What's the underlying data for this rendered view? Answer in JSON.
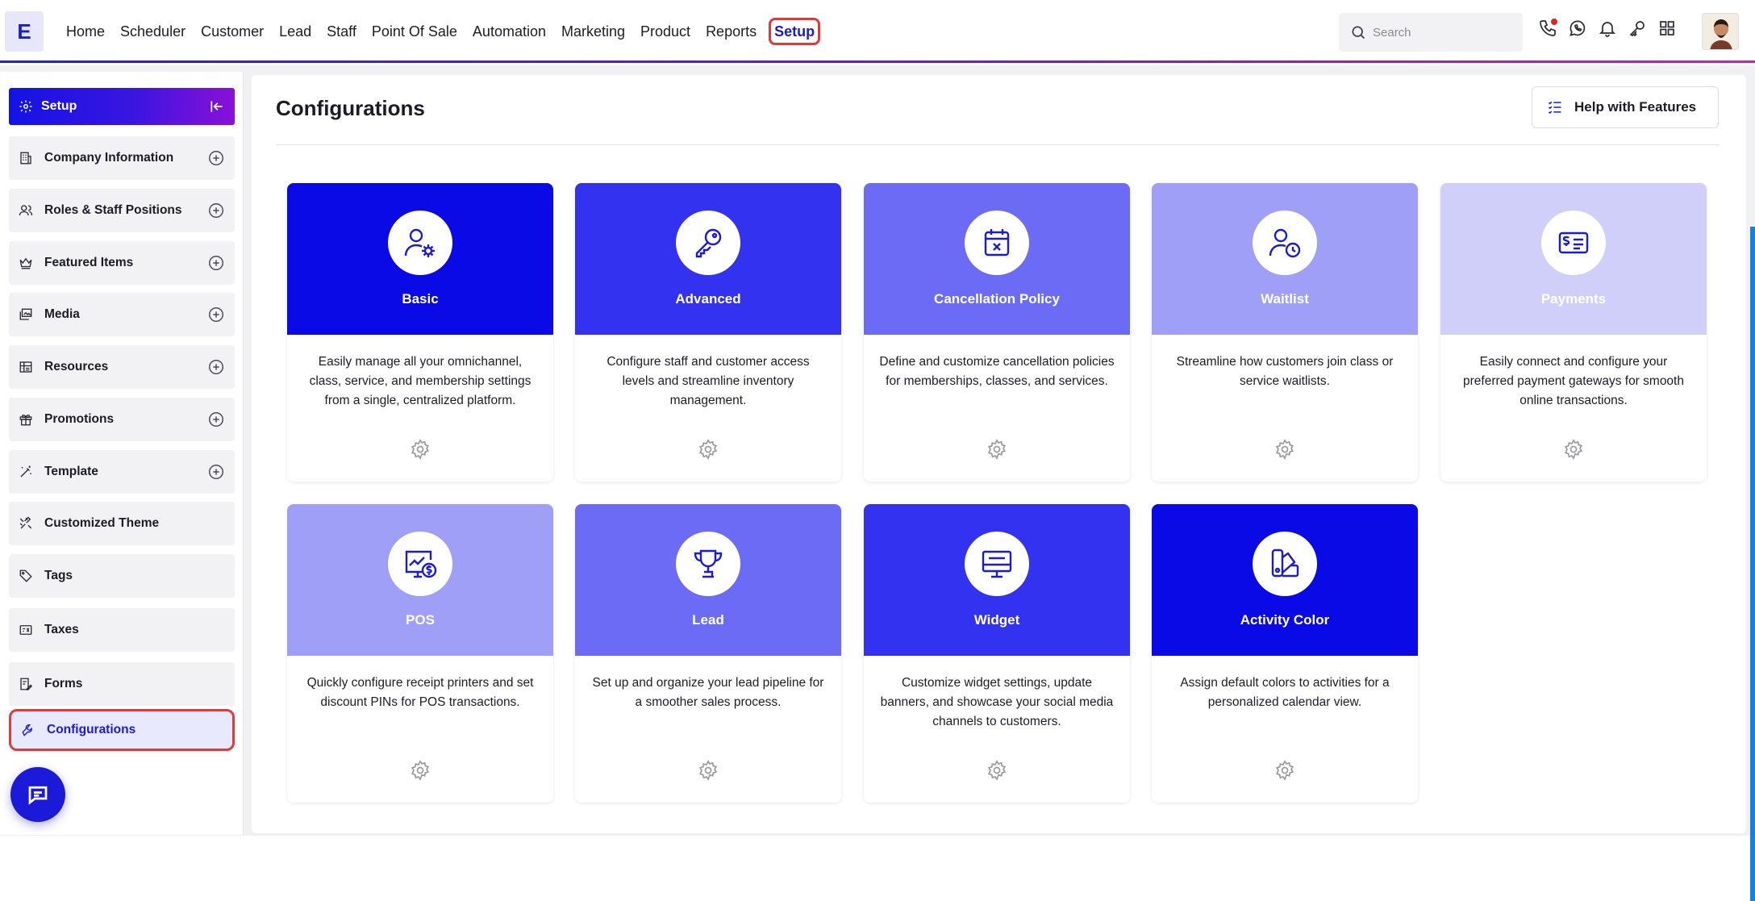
{
  "app": {
    "logo_letter": "E"
  },
  "nav": {
    "items": [
      "Home",
      "Scheduler",
      "Customer",
      "Lead",
      "Staff",
      "Point Of Sale",
      "Automation",
      "Marketing",
      "Product",
      "Reports",
      "Setup"
    ],
    "active": "Setup"
  },
  "search": {
    "placeholder": "Search"
  },
  "sidebar": {
    "title": "Setup",
    "items": [
      {
        "label": "Company Information",
        "icon": "building-icon",
        "expandable": true
      },
      {
        "label": "Roles & Staff Positions",
        "icon": "users-icon",
        "expandable": true
      },
      {
        "label": "Featured Items",
        "icon": "crown-icon",
        "expandable": true
      },
      {
        "label": "Media",
        "icon": "media-icon",
        "expandable": true
      },
      {
        "label": "Resources",
        "icon": "resources-icon",
        "expandable": true
      },
      {
        "label": "Promotions",
        "icon": "gift-icon",
        "expandable": true
      },
      {
        "label": "Template",
        "icon": "wand-icon",
        "expandable": true
      },
      {
        "label": "Customized Theme",
        "icon": "palette-icon",
        "expandable": false
      },
      {
        "label": "Tags",
        "icon": "tag-icon",
        "expandable": false
      },
      {
        "label": "Taxes",
        "icon": "tax-icon",
        "expandable": false
      },
      {
        "label": "Forms",
        "icon": "form-icon",
        "expandable": false
      },
      {
        "label": "Configurations",
        "icon": "wrench-icon",
        "expandable": false,
        "active": true
      }
    ]
  },
  "main": {
    "title": "Configurations",
    "help_button": "Help with Features",
    "cards": [
      {
        "title": "Basic",
        "desc": "Easily manage all your omnichannel, class, service, and membership settings from a single, centralized platform.",
        "color": "#0a0ae6",
        "icon": "user-settings-icon"
      },
      {
        "title": "Advanced",
        "desc": "Configure staff and customer access levels and streamline inventory management.",
        "color": "#3232f0",
        "icon": "key-icon"
      },
      {
        "title": "Cancellation Policy",
        "desc": "Define and customize cancellation policies for memberships, classes, and services.",
        "color": "#6b6bf5",
        "icon": "calendar-x-icon"
      },
      {
        "title": "Waitlist",
        "desc": "Streamline how customers join class or service waitlists.",
        "color": "#9f9ff7",
        "icon": "user-clock-icon"
      },
      {
        "title": "Payments",
        "desc": "Easily connect and configure your preferred payment gateways for smooth online transactions.",
        "color": "#cfcffa",
        "icon": "payment-card-icon"
      },
      {
        "title": "POS",
        "desc": "Quickly configure receipt printers and set discount PINs for POS transactions.",
        "color": "#9f9ff7",
        "icon": "pos-monitor-icon"
      },
      {
        "title": "Lead",
        "desc": "Set up and organize your lead pipeline for a smoother sales process.",
        "color": "#6b6bf5",
        "icon": "trophy-icon"
      },
      {
        "title": "Widget",
        "desc": "Customize widget settings, update banners, and showcase your social media channels to customers.",
        "color": "#3232f0",
        "icon": "monitor-icon"
      },
      {
        "title": "Activity Color",
        "desc": "Assign default colors to activities for a personalized calendar view.",
        "color": "#0a0ae6",
        "icon": "color-swatch-icon"
      }
    ]
  }
}
